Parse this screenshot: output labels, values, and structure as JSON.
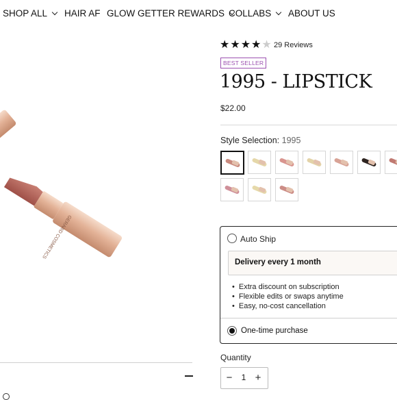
{
  "nav": {
    "items": [
      {
        "label": "SHOP ALL",
        "has_dropdown": true
      },
      {
        "label": "HAIR AF",
        "has_dropdown": false
      },
      {
        "label": "GLOW GETTER REWARDS",
        "has_dropdown": true
      },
      {
        "label": "COLLABS",
        "has_dropdown": true
      },
      {
        "label": "ABOUT US",
        "has_dropdown": false
      }
    ]
  },
  "product": {
    "rating": 4.5,
    "reviews_label": "29 Reviews",
    "badge": "BEST SELLER",
    "title": "1995 - LIPSTICK",
    "price": "$22.00",
    "style_label": "Style Selection:",
    "style_value": "1995",
    "swatches": [
      {
        "color": "#c98a7e",
        "selected": true
      },
      {
        "color": "#e5d7a9",
        "selected": false
      },
      {
        "color": "#d9958f",
        "selected": false
      },
      {
        "color": "#e3d3a8",
        "selected": false
      },
      {
        "color": "#d8a396",
        "selected": false
      },
      {
        "color": "#2e2420",
        "selected": false
      },
      {
        "color": "#c07a72",
        "selected": false
      },
      {
        "color": "#cf8f99",
        "selected": false
      },
      {
        "color": "#e6d9aa",
        "selected": false
      },
      {
        "color": "#cc8c86",
        "selected": false
      }
    ],
    "accent_color": "#9b4fb0"
  },
  "subscription": {
    "auto_ship_label": "Auto Ship",
    "auto_ship_selected": false,
    "frequency": "Delivery every 1 month",
    "benefits": [
      "Extra discount on subscription",
      "Flexible edits or swaps anytime",
      "Easy, no-cost cancellation"
    ],
    "one_time_label": "One-time purchase",
    "one_time_selected": true
  },
  "quantity": {
    "label": "Quantity",
    "value": "1",
    "minus_icon": "minus-icon",
    "plus_icon": "plus-icon"
  },
  "gallery": {
    "brand_text": "GERARD COSMETICS",
    "lipstick_color": "#b9695f",
    "tube_color": "#e8b9a1"
  }
}
